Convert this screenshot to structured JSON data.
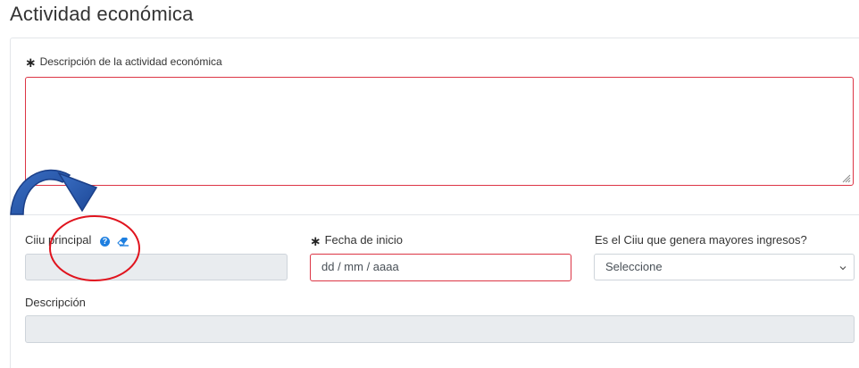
{
  "section": {
    "title": "Actividad económica"
  },
  "descripcion_actividad": {
    "required_mark": "∗",
    "label": "Descripción de la actividad económica",
    "value": ""
  },
  "ciiu_principal": {
    "label": "Ciiu principal",
    "help_icon": "question-circle-icon",
    "eraser_icon": "eraser-icon",
    "value": ""
  },
  "fecha_inicio": {
    "required_mark": "∗",
    "label": "Fecha de inicio",
    "placeholder": "dd / mm / aaaa"
  },
  "mayores_ingresos": {
    "label": "Es el Ciiu que genera mayores ingresos?",
    "selected": "Seleccione",
    "icon": "chevron-down-icon"
  },
  "descripcion": {
    "label": "Descripción",
    "value": ""
  },
  "annotation": {
    "arrow_icon": "curved-arrow-icon",
    "circle_icon": "red-circle-highlight-icon",
    "arrow_color": "#2456a6",
    "circle_color": "#e0141e"
  },
  "colors": {
    "invalid_border": "#dc3545",
    "disabled_bg": "#e9ecef",
    "help_icon": "#1e7fe0"
  }
}
